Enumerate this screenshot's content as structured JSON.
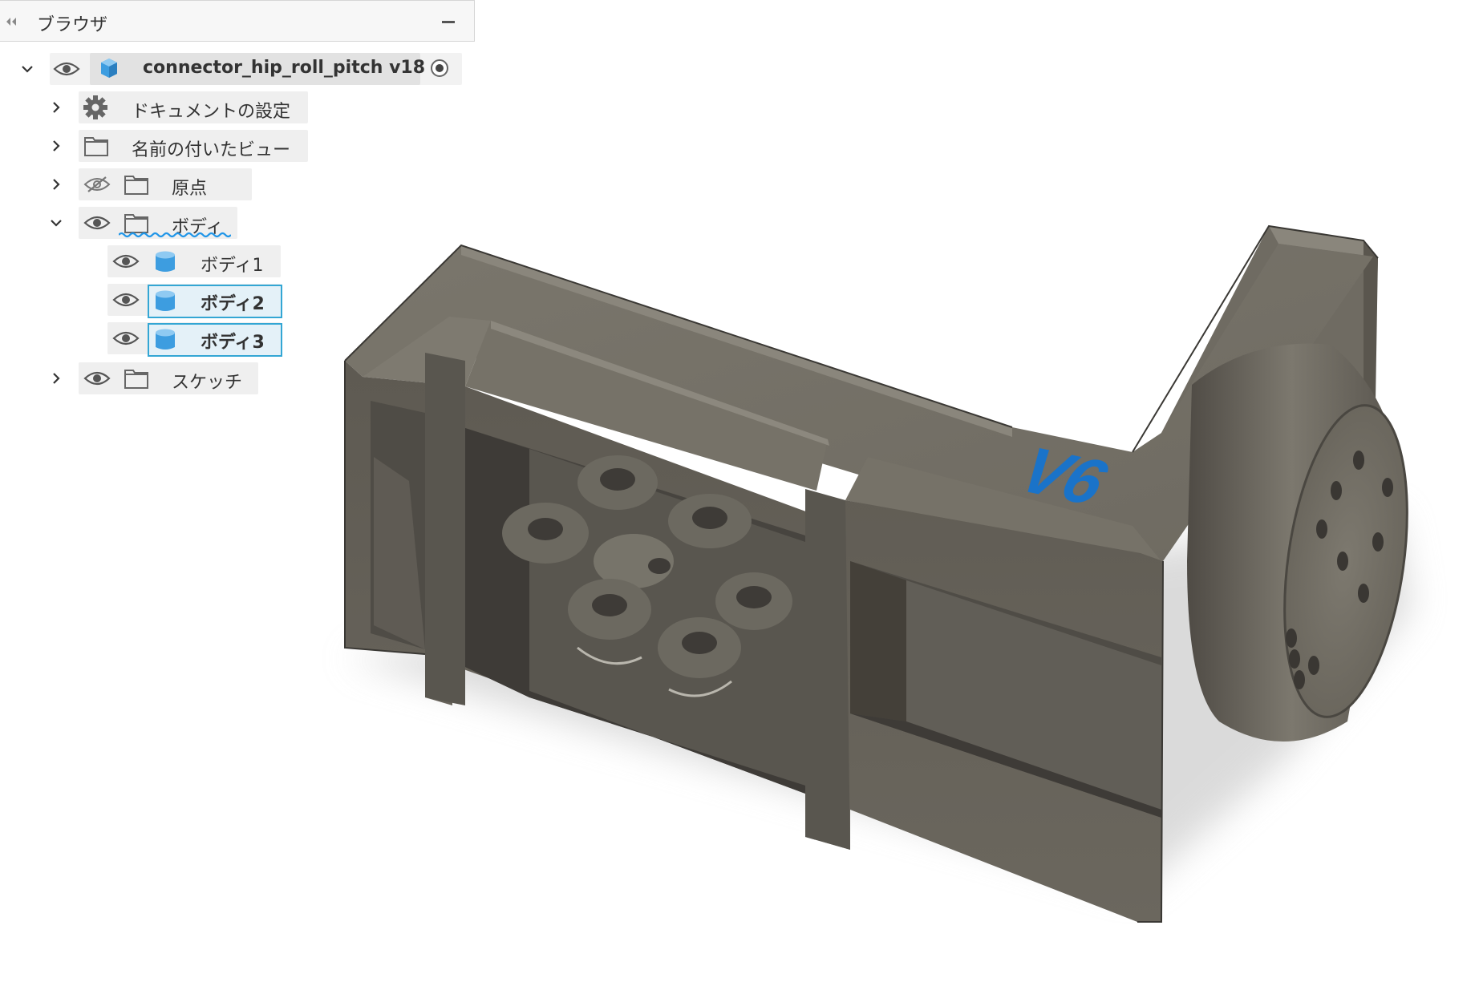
{
  "panel": {
    "title": "ブラウザ"
  },
  "root": {
    "label": "connector_hip_roll_pitch v18"
  },
  "tree": {
    "doc_settings": "ドキュメントの設定",
    "named_views": "名前の付いたビュー",
    "origin": "原点",
    "bodies": "ボディ",
    "body1": "ボディ1",
    "body2": "ボディ2",
    "body3": "ボディ3",
    "sketches": "スケッチ"
  },
  "model": {
    "engraved_text": "V6"
  },
  "colors": {
    "accent": "#33a6d4",
    "body_icon": "#4aa8e0",
    "part_gray": "#6a665e",
    "engrave_blue": "#1a73c9"
  }
}
